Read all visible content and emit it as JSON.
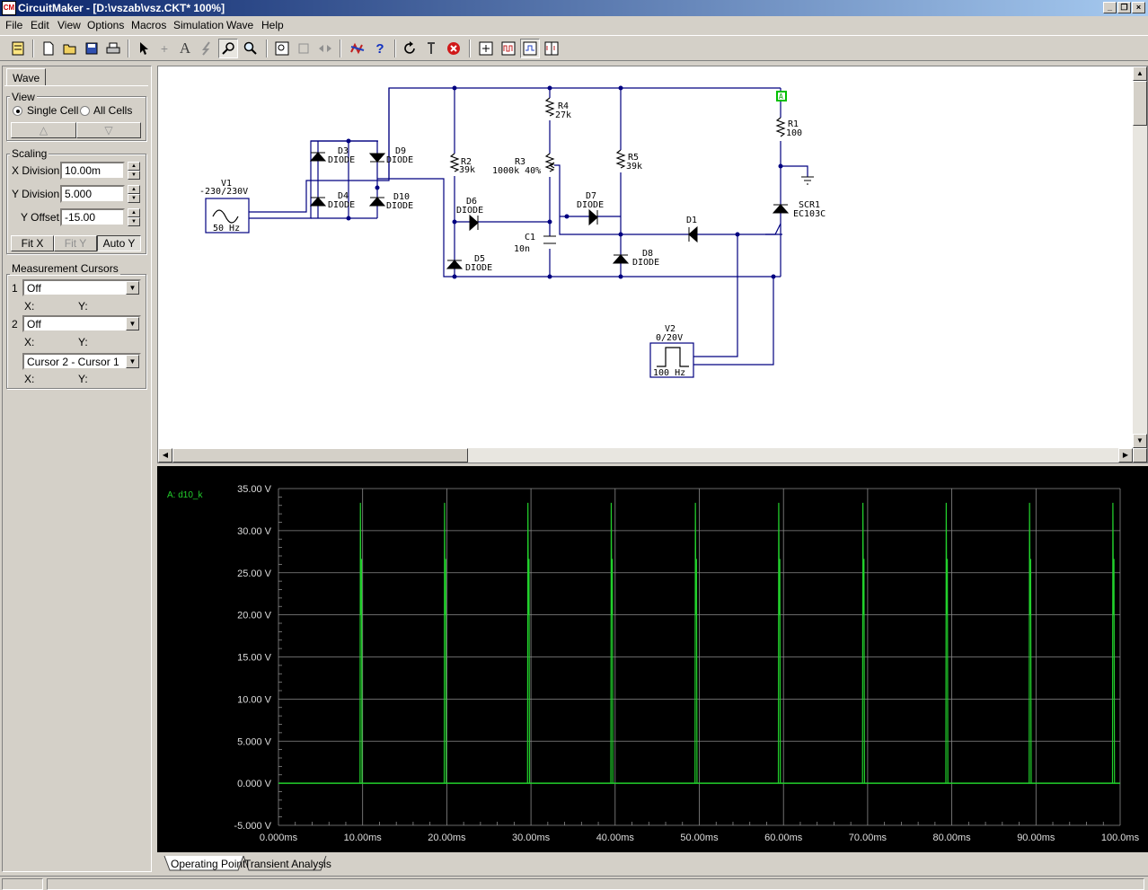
{
  "window": {
    "title": "CircuitMaker - [D:\\vszab\\vsz.CKT* 100%]",
    "min": "_",
    "restore": "❐",
    "close": "×"
  },
  "menu": [
    "File",
    "Edit",
    "View",
    "Options",
    "Macros",
    "Simulation",
    "Wave",
    "Help"
  ],
  "left_panel": {
    "tab": "Wave",
    "view": {
      "legend": "View",
      "single_cell": "Single Cell",
      "all_cells": "All Cells",
      "selected": "single_cell",
      "up": "△",
      "down": "▽"
    },
    "scaling": {
      "legend": "Scaling",
      "x_division_label": "X Division",
      "x_division_value": "10.00m",
      "y_division_label": "Y Division",
      "y_division_value": "5.000",
      "y_offset_label": "Y Offset",
      "y_offset_value": "-15.00",
      "fit_x": "Fit X",
      "fit_y": "Fit Y",
      "auto_y": "Auto Y"
    },
    "cursors": {
      "legend": "Measurement Cursors",
      "cursor1_num": "1",
      "cursor1_value": "Off",
      "cursor2_num": "2",
      "cursor2_value": "Off",
      "diff_value": "Cursor 2 - Cursor 1",
      "x_label": "X:",
      "y_label": "Y:"
    }
  },
  "schematic": {
    "labels": {
      "v1": "V1",
      "v1_range": "-230/230V",
      "v1_freq": "50 Hz",
      "d3": "D3",
      "d4": "D4",
      "d9": "D9",
      "d10": "D10",
      "d5": "D5",
      "d6": "D6",
      "d7": "D7",
      "d8": "D8",
      "d1": "D1",
      "diode": "DIODE",
      "r2": "R2",
      "r2_val": "39k",
      "r3": "R3",
      "r3_val": "1000k 40%",
      "r4": "R4",
      "r4_val": "27k",
      "r5": "R5",
      "r5_val": "39k",
      "r1": "R1",
      "r1_val": "100",
      "c1": "C1",
      "c1_val": "10n",
      "scr": "SCR1",
      "scr_model": "EC103C",
      "v2": "V2",
      "v2_range": "0/20V",
      "v2_freq": "100 Hz",
      "probe": "A"
    }
  },
  "chart_data": {
    "type": "line",
    "series": [
      {
        "name": "A: d10_k",
        "color": "#22d02c",
        "pulse_times_ms": [
          9.8,
          19.8,
          29.7,
          39.6,
          49.6,
          59.5,
          69.5,
          79.4,
          89.3,
          99.2
        ],
        "peak_v": 33.3,
        "baseline_v": 0.0
      }
    ],
    "y_ticks": [
      "35.00 V",
      "30.00 V",
      "25.00 V",
      "20.00 V",
      "15.00 V",
      "10.00 V",
      "5.000 V",
      "0.000 V",
      "-5.000 V"
    ],
    "x_ticks": [
      "0.000ms",
      "10.00ms",
      "20.00ms",
      "30.00ms",
      "40.00ms",
      "50.00ms",
      "60.00ms",
      "70.00ms",
      "80.00ms",
      "90.00ms",
      "100.0ms"
    ],
    "xlim": [
      0,
      100
    ],
    "ylim": [
      -5,
      35
    ],
    "grid": true
  },
  "bottom_tabs": [
    "Operating Point",
    "Transient Analysis"
  ]
}
